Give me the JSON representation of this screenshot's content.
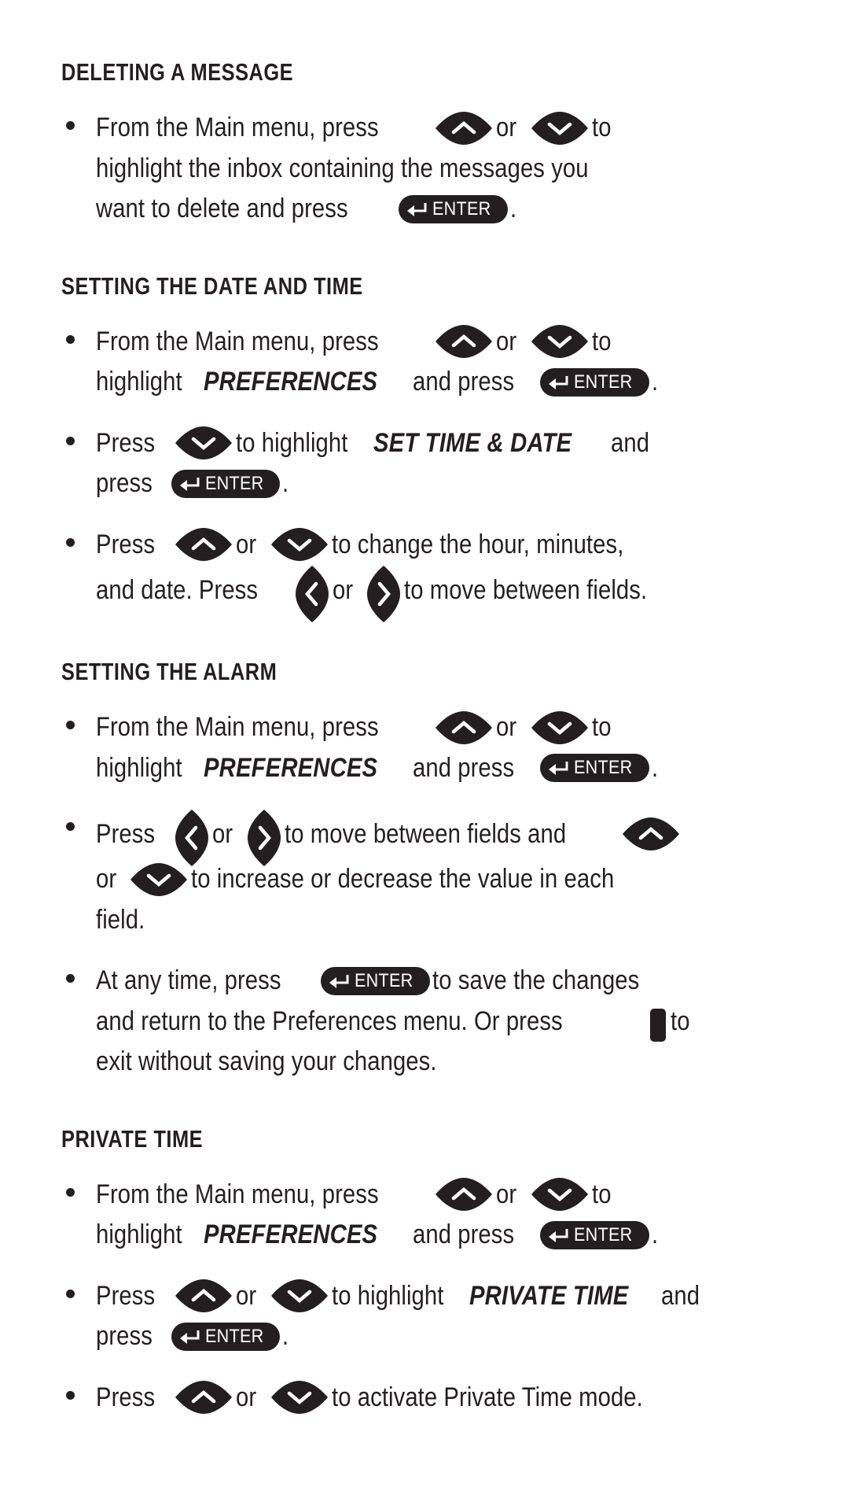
{
  "document": {
    "type": "device-user-manual-page",
    "text_color": "#231f20",
    "background_color": "#ffffff",
    "icons": {
      "up_arrow": "up-arrow-key-icon",
      "down_arrow": "down-arrow-key-icon",
      "left_arrow": "left-arrow-key-icon",
      "right_arrow": "right-arrow-key-icon",
      "enter": "enter-key-icon",
      "enter_label": "ENTER",
      "enter_glyph": "return-arrow",
      "exit_bar": "exit-key-icon"
    }
  },
  "sections": [
    {
      "id": "deleting-a-message",
      "heading": "DELETING A MESSAGE",
      "bullets": [
        {
          "id": "delete-step-1",
          "lines": [
            [
              {
                "t": "text",
                "v": "From the Main menu, press"
              },
              {
                "t": "icon",
                "v": "up"
              },
              {
                "t": "text",
                "v": "or"
              },
              {
                "t": "icon",
                "v": "down"
              },
              {
                "t": "text",
                "v": "to"
              }
            ],
            [
              {
                "t": "text",
                "v": "highlight the inbox containing the messages you"
              }
            ],
            [
              {
                "t": "text",
                "v": "want to delete and press"
              },
              {
                "t": "icon",
                "v": "enter"
              },
              {
                "t": "text",
                "v": "."
              }
            ]
          ]
        }
      ]
    },
    {
      "id": "setting-the-date-and-time",
      "heading": "SETTING THE DATE AND TIME",
      "bullets": [
        {
          "id": "datetime-step-1",
          "lines": [
            [
              {
                "t": "text",
                "v": "From the Main menu, press"
              },
              {
                "t": "icon",
                "v": "up"
              },
              {
                "t": "text",
                "v": "or"
              },
              {
                "t": "icon",
                "v": "down"
              },
              {
                "t": "text",
                "v": "to"
              }
            ],
            [
              {
                "t": "text",
                "v": "highlight"
              },
              {
                "t": "ital",
                "v": "PREFERENCES"
              },
              {
                "t": "text",
                "v": "and press"
              },
              {
                "t": "icon",
                "v": "enter"
              },
              {
                "t": "text",
                "v": "."
              }
            ]
          ]
        },
        {
          "id": "datetime-step-2",
          "lines": [
            [
              {
                "t": "text",
                "v": "Press"
              },
              {
                "t": "icon",
                "v": "down"
              },
              {
                "t": "text",
                "v": "to highlight"
              },
              {
                "t": "ital",
                "v": "SET TIME & DATE"
              },
              {
                "t": "text",
                "v": "and"
              }
            ],
            [
              {
                "t": "text",
                "v": "press"
              },
              {
                "t": "icon",
                "v": "enter"
              },
              {
                "t": "text",
                "v": "."
              }
            ]
          ]
        },
        {
          "id": "datetime-step-3",
          "lines": [
            [
              {
                "t": "text",
                "v": "Press"
              },
              {
                "t": "icon",
                "v": "up"
              },
              {
                "t": "text",
                "v": "or"
              },
              {
                "t": "icon",
                "v": "down"
              },
              {
                "t": "text",
                "v": "to change the hour, minutes,"
              }
            ],
            [
              {
                "t": "text",
                "v": "and date. Press"
              },
              {
                "t": "icon",
                "v": "left"
              },
              {
                "t": "text",
                "v": "or"
              },
              {
                "t": "icon",
                "v": "right"
              },
              {
                "t": "text",
                "v": "to move between fields."
              }
            ]
          ]
        }
      ]
    },
    {
      "id": "setting-the-alarm",
      "heading": "SETTING THE ALARM",
      "bullets": [
        {
          "id": "alarm-step-1",
          "lines": [
            [
              {
                "t": "text",
                "v": "From the Main menu, press"
              },
              {
                "t": "icon",
                "v": "up"
              },
              {
                "t": "text",
                "v": "or"
              },
              {
                "t": "icon",
                "v": "down"
              },
              {
                "t": "text",
                "v": "to"
              }
            ],
            [
              {
                "t": "text",
                "v": "highlight"
              },
              {
                "t": "ital",
                "v": "PREFERENCES"
              },
              {
                "t": "text",
                "v": "and press"
              },
              {
                "t": "icon",
                "v": "enter"
              },
              {
                "t": "text",
                "v": "."
              }
            ]
          ]
        },
        {
          "id": "alarm-step-2",
          "lines": [
            [
              {
                "t": "text",
                "v": "Press"
              },
              {
                "t": "icon",
                "v": "left"
              },
              {
                "t": "text",
                "v": "or"
              },
              {
                "t": "icon",
                "v": "right"
              },
              {
                "t": "text",
                "v": "to move between fields and"
              },
              {
                "t": "icon",
                "v": "up"
              }
            ],
            [
              {
                "t": "text",
                "v": "or"
              },
              {
                "t": "icon",
                "v": "down"
              },
              {
                "t": "text",
                "v": "to increase or decrease the value in each"
              }
            ],
            [
              {
                "t": "text",
                "v": "field."
              }
            ]
          ]
        },
        {
          "id": "alarm-step-3",
          "lines": [
            [
              {
                "t": "text",
                "v": "At any time, press"
              },
              {
                "t": "icon",
                "v": "enter"
              },
              {
                "t": "text",
                "v": "to save the changes"
              }
            ],
            [
              {
                "t": "text",
                "v": "and return to the Preferences menu. Or press"
              },
              {
                "t": "icon",
                "v": "bar"
              },
              {
                "t": "text",
                "v": "to"
              }
            ],
            [
              {
                "t": "text",
                "v": "exit without saving your changes."
              }
            ]
          ]
        }
      ]
    },
    {
      "id": "private-time",
      "heading": "PRIVATE TIME",
      "bullets": [
        {
          "id": "private-step-1",
          "lines": [
            [
              {
                "t": "text",
                "v": "From the Main menu, press"
              },
              {
                "t": "icon",
                "v": "up"
              },
              {
                "t": "text",
                "v": "or"
              },
              {
                "t": "icon",
                "v": "down"
              },
              {
                "t": "text",
                "v": "to"
              }
            ],
            [
              {
                "t": "text",
                "v": "highlight"
              },
              {
                "t": "ital",
                "v": "PREFERENCES"
              },
              {
                "t": "text",
                "v": "and press"
              },
              {
                "t": "icon",
                "v": "enter"
              },
              {
                "t": "text",
                "v": "."
              }
            ]
          ]
        },
        {
          "id": "private-step-2",
          "lines": [
            [
              {
                "t": "text",
                "v": "Press"
              },
              {
                "t": "icon",
                "v": "up"
              },
              {
                "t": "text",
                "v": "or"
              },
              {
                "t": "icon",
                "v": "down"
              },
              {
                "t": "text",
                "v": "to highlight"
              },
              {
                "t": "ital",
                "v": "PRIVATE TIME"
              },
              {
                "t": "text",
                "v": "and"
              }
            ],
            [
              {
                "t": "text",
                "v": "press"
              },
              {
                "t": "icon",
                "v": "enter"
              },
              {
                "t": "text",
                "v": "."
              }
            ]
          ]
        },
        {
          "id": "private-step-3",
          "lines": [
            [
              {
                "t": "text",
                "v": "Press"
              },
              {
                "t": "icon",
                "v": "up"
              },
              {
                "t": "text",
                "v": "or"
              },
              {
                "t": "icon",
                "v": "down"
              },
              {
                "t": "text",
                "v": "to activate Private Time mode."
              }
            ]
          ]
        }
      ]
    }
  ]
}
